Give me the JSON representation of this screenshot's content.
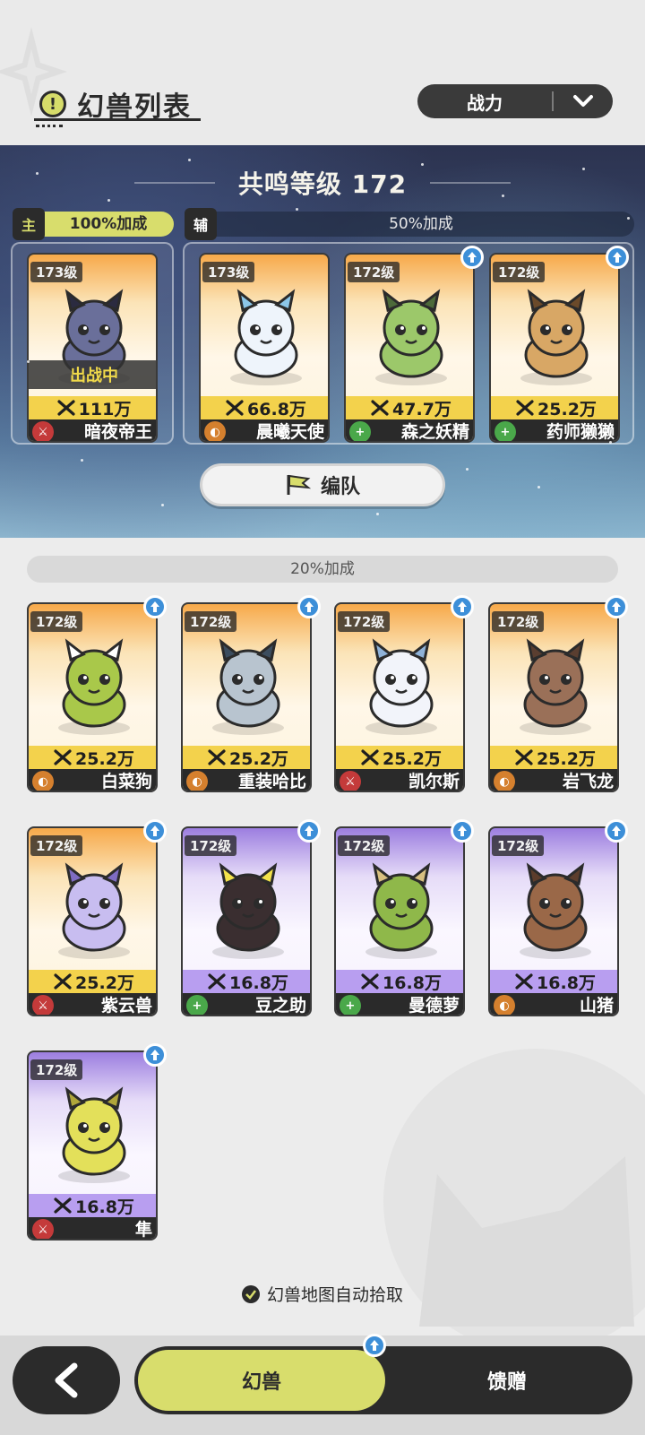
{
  "header": {
    "title": "幻兽列表",
    "title_icon": "alert-icon",
    "sort_label": "战力"
  },
  "banner": {
    "resonance": "共鸣等级 172",
    "main_tag": "主",
    "main_bonus": "100%加成",
    "sub_tag": "辅",
    "sub_bonus": "50%加成",
    "form_button": "编队",
    "in_battle": "出战中"
  },
  "team": [
    {
      "level": "173级",
      "power": "111万",
      "name": "暗夜帝王",
      "role": "attack",
      "rarity": "orange",
      "upgrade": false,
      "in_battle": true,
      "body": "#6a6f9a",
      "accent": "#2b2b40"
    },
    {
      "level": "173级",
      "power": "66.8万",
      "name": "晨曦天使",
      "role": "defense",
      "rarity": "orange",
      "upgrade": false,
      "in_battle": false,
      "body": "#eef4fb",
      "accent": "#8cc6e8"
    },
    {
      "level": "172级",
      "power": "47.7万",
      "name": "森之妖精",
      "role": "heal",
      "rarity": "orange",
      "upgrade": true,
      "in_battle": false,
      "body": "#9cc86a",
      "accent": "#4d6a3a"
    },
    {
      "level": "172级",
      "power": "25.2万",
      "name": "药师獭獭",
      "role": "heal",
      "rarity": "orange",
      "upgrade": true,
      "in_battle": false,
      "body": "#d8a765",
      "accent": "#6b4a2a"
    }
  ],
  "pool_bonus": "20%加成",
  "roster": [
    {
      "level": "172级",
      "power": "25.2万",
      "name": "白菜狗",
      "role": "defense",
      "rarity": "orange",
      "upgrade": true,
      "body": "#a9c84a",
      "accent": "#ffffff"
    },
    {
      "level": "172级",
      "power": "25.2万",
      "name": "重装哈比",
      "role": "defense",
      "rarity": "orange",
      "upgrade": true,
      "body": "#b8c4cf",
      "accent": "#3c4d5e"
    },
    {
      "level": "172级",
      "power": "25.2万",
      "name": "凯尔斯",
      "role": "attack",
      "rarity": "orange",
      "upgrade": true,
      "body": "#f2f4fa",
      "accent": "#8fb2d8"
    },
    {
      "level": "172级",
      "power": "25.2万",
      "name": "岩飞龙",
      "role": "defense",
      "rarity": "orange",
      "upgrade": true,
      "body": "#9a7058",
      "accent": "#5a3e30"
    },
    {
      "level": "172级",
      "power": "25.2万",
      "name": "紫云兽",
      "role": "attack",
      "rarity": "orange",
      "upgrade": true,
      "body": "#c8bdf0",
      "accent": "#7e6cc2"
    },
    {
      "level": "172级",
      "power": "16.8万",
      "name": "豆之助",
      "role": "heal",
      "rarity": "purple",
      "upgrade": true,
      "body": "#3a2e30",
      "accent": "#f3e24a"
    },
    {
      "level": "172级",
      "power": "16.8万",
      "name": "曼德萝",
      "role": "heal",
      "rarity": "purple",
      "upgrade": true,
      "body": "#8fb84a",
      "accent": "#d8c080"
    },
    {
      "level": "172级",
      "power": "16.8万",
      "name": "山猪",
      "role": "defense",
      "rarity": "purple",
      "upgrade": true,
      "body": "#9a6848",
      "accent": "#5c3d2c"
    },
    {
      "level": "172级",
      "power": "16.8万",
      "name": "隼",
      "role": "attack",
      "rarity": "purple",
      "upgrade": true,
      "body": "#e3e05a",
      "accent": "#b0a63a"
    }
  ],
  "auto_pick": "幻兽地图自动拾取",
  "nav": {
    "tab_beasts": "幻兽",
    "tab_gift": "馈赠"
  },
  "colors": {
    "accent_green": "#d8dd6c",
    "dark": "#2b2b2b",
    "upgrade_blue": "#3d8fd8"
  }
}
